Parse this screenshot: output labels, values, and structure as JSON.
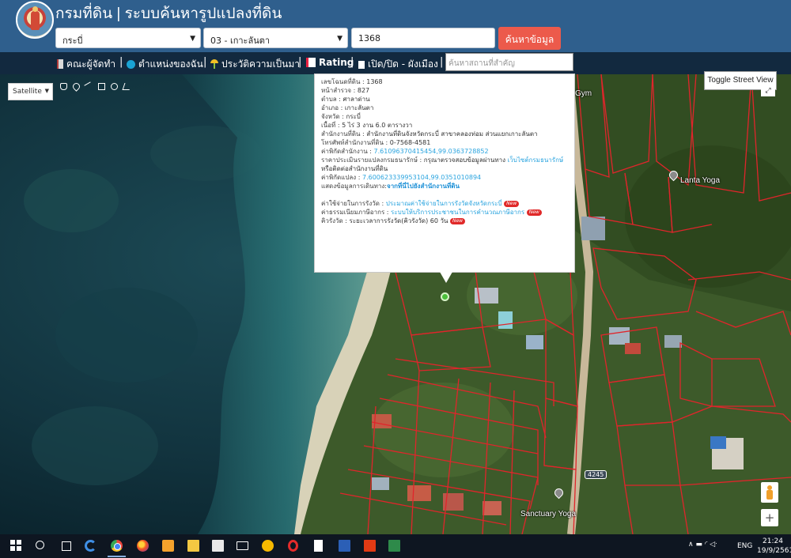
{
  "header": {
    "title": "กรมที่ดิน | ระบบค้นหารูปแปลงที่ดิน",
    "province_value": "กระบี่",
    "district_value": "03 - เกาะลันตา",
    "parcel_value": "1368",
    "search_label": "ค้นหาข้อมูล"
  },
  "toolbar": {
    "team_label": "คณะผู้จัดทำ",
    "location_label": "ตำแหน่งของฉัน",
    "history_label": "ประวัติความเป็นมา",
    "rating_label": "Rating",
    "toggle_plan_label": "เปิด/ปิด - ผังเมือง",
    "separator": "|",
    "place_search_placeholder": "ค้นหาสถานที่สำคัญ"
  },
  "map": {
    "map_type": "Satellite",
    "toggle_street_view": "Toggle Street View",
    "labels": {
      "gym": "Gym",
      "lanta_yoga": "Lanta Yoga",
      "sanctuary_yoga": "Sanctuary Yoga",
      "road_number": "4245"
    },
    "zoom_in": "+",
    "expand": "⤢"
  },
  "popup": {
    "deed_label": "เลขโฉนดที่ดิน : ",
    "deed_value": "1368",
    "survey_label": "หน้าสำรวจ : ",
    "survey_value": "827",
    "tambon_label": "ตำบล : ",
    "tambon_value": "ศาลาด่าน",
    "amphoe_label": "อำเภอ : ",
    "amphoe_value": "เกาะลันตา",
    "province_label": "จังหวัด : ",
    "province_value": "กระบี่",
    "area_label": "เนื้อที่ : ",
    "area_value": "5 ไร่ 3 งาน 6.0 ตารางวา",
    "office_label": "สำนักงานที่ดิน : ",
    "office_value": "สำนักงานที่ดินจังหวัดกระบี่ สาขาคลองท่อม ส่วนแยกเกาะลันตา",
    "phone_label": "โทรศัพท์สำนักงานที่ดิน : ",
    "phone_value": "0-7568-4581",
    "office_coord_label": "ค่าพิกัดสำนักงาน : ",
    "office_coord_value": "7.61096370415454,99.0363728852",
    "price_label": "ราคาประเมินรายแปลงกรมธนารักษ์ : ",
    "price_text": "กรุณาตรวจสอบข้อมูลผ่านทาง ",
    "price_link": "เว็บไซต์กรมธนารักษ์",
    "price_line2": "หรือติดต่อสำนักงานที่ดิน",
    "parcel_coord_label": "ค่าพิกัดแปลง : ",
    "parcel_coord_value": "7.600623339953104,99.0351010894",
    "route_label": "แสดงข้อมูลการเดินทาง:",
    "route_link": "จากที่นี่ไปยังสำนักงานที่ดิน",
    "fee_label": "ค่าใช้จ่ายในการรังวัด : ",
    "fee_link": "ประมาณค่าใช้จ่ายในการรังวัดจังหวัดกระบี่",
    "tax_label": "ค่าธรรมเนียมภาษีอากร : ",
    "tax_link": "ระบบให้บริการประชาชนในการคำนวณภาษีอากร",
    "queue_label": "คิวรังวัด : ",
    "queue_value": "ระยะเวลาการรังวัด(คิวรังวัด) 60 วัน",
    "new_badge": "New"
  },
  "taskbar": {
    "language": "ENG",
    "time": "21:24",
    "date": "19/9/2561",
    "tray_icons": "∧ ▬ ◜ ◁ᐧ"
  },
  "colors": {
    "header_bg": "#2f5f8d",
    "toolbar_bg": "#12293f",
    "search_button": "#ec5a4b",
    "parcel_line": "#e0252b",
    "link": "#2aa4df"
  },
  "icons": [
    "team-icon",
    "location-icon",
    "history-icon",
    "rating-icon",
    "city-plan-icon",
    "hand-tool-icon",
    "marker-tool-icon",
    "polyline-tool-icon",
    "rectangle-tool-icon",
    "circle-tool-icon",
    "cursor-tool-icon",
    "pegman-icon",
    "windows-start-icon",
    "search-icon",
    "task-view-icon",
    "edge-icon",
    "chrome-icon",
    "firefox-icon",
    "paint-icon",
    "file-explorer-icon",
    "store-icon",
    "mail-icon",
    "shield-icon",
    "opera-icon",
    "document-icon",
    "word-icon",
    "office-icon",
    "project-icon"
  ]
}
